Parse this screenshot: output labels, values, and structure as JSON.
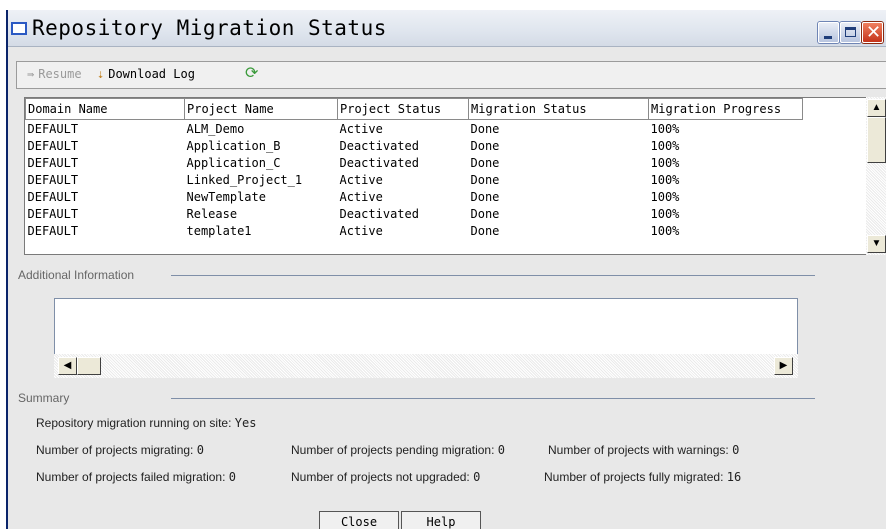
{
  "window": {
    "title": "Repository Migration Status"
  },
  "toolbar": {
    "resume_label": "Resume",
    "download_label": "Download Log"
  },
  "table": {
    "columns": [
      "Domain Name",
      "Project Name",
      "Project Status",
      "Migration Status",
      "Migration Progress"
    ],
    "rows": [
      [
        "DEFAULT",
        "ALM_Demo",
        "Active",
        "Done",
        "100%"
      ],
      [
        "DEFAULT",
        "Application_B",
        "Deactivated",
        "Done",
        "100%"
      ],
      [
        "DEFAULT",
        "Application_C",
        "Deactivated",
        "Done",
        "100%"
      ],
      [
        "DEFAULT",
        "Linked_Project_1",
        "Active",
        "Done",
        "100%"
      ],
      [
        "DEFAULT",
        "NewTemplate",
        "Active",
        "Done",
        "100%"
      ],
      [
        "DEFAULT",
        "Release",
        "Deactivated",
        "Done",
        "100%"
      ],
      [
        "DEFAULT",
        "template1",
        "Active",
        "Done",
        "100%"
      ]
    ]
  },
  "additional_info": {
    "label": "Additional Information"
  },
  "summary": {
    "label": "Summary",
    "running_label": "Repository migration running on site:",
    "running_value": "Yes",
    "migrating_label": "Number of projects migrating:",
    "migrating_value": "0",
    "pending_label": "Number of projects pending migration:",
    "pending_value": "0",
    "warnings_label": "Number of projects with warnings:",
    "warnings_value": "0",
    "failed_label": "Number of projects failed migration:",
    "failed_value": "0",
    "not_upgraded_label": "Number of projects not upgraded:",
    "not_upgraded_value": "0",
    "fully_migrated_label": "Number of projects fully migrated:",
    "fully_migrated_value": "16"
  },
  "buttons": {
    "close": "Close",
    "help": "Help"
  },
  "icons": {
    "window": "window-icon",
    "resume": "play-icon",
    "download": "download-log-icon",
    "refresh": "refresh-icon"
  }
}
